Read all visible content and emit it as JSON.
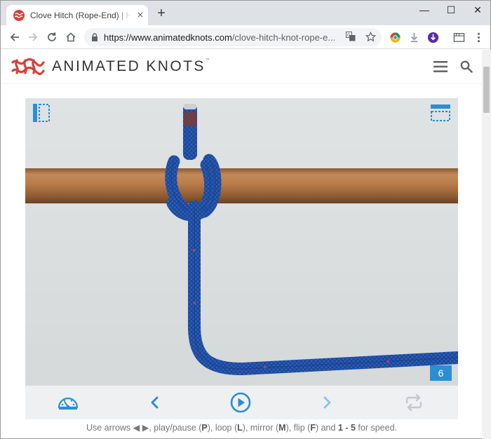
{
  "browser": {
    "tab_title": "Clove Hitch (Rope-End) | How to tie",
    "tab_close": "×",
    "new_tab": "+",
    "window_controls": {
      "minimize": "—",
      "maximize": "☐",
      "close": "✕"
    },
    "url_host": "https://www.animatedknots.com",
    "url_path": "/clove-hitch-knot-rope-e..."
  },
  "site": {
    "brand": "ANIMATED KNOTS",
    "brand_mark": "™",
    "accent_color": "#2b8ed3",
    "logo_color": "#d8403a"
  },
  "player": {
    "frame_number": "6",
    "controls": [
      "speed-gauge-icon",
      "chevron-left-icon",
      "play-icon",
      "chevron-right-icon",
      "loop-icon"
    ],
    "hint": {
      "prefix": "Use arrows ◀ ▶, play/pause (",
      "play_key": "P",
      "loop_text": "), loop (",
      "loop_key": "L",
      "mirror_text": "), mirror (",
      "mirror_key": "M",
      "flip_text": "), flip (",
      "flip_key": "F",
      "and_text": ") and ",
      "speed_keys": "1 - 5",
      "suffix": " for speed."
    }
  }
}
